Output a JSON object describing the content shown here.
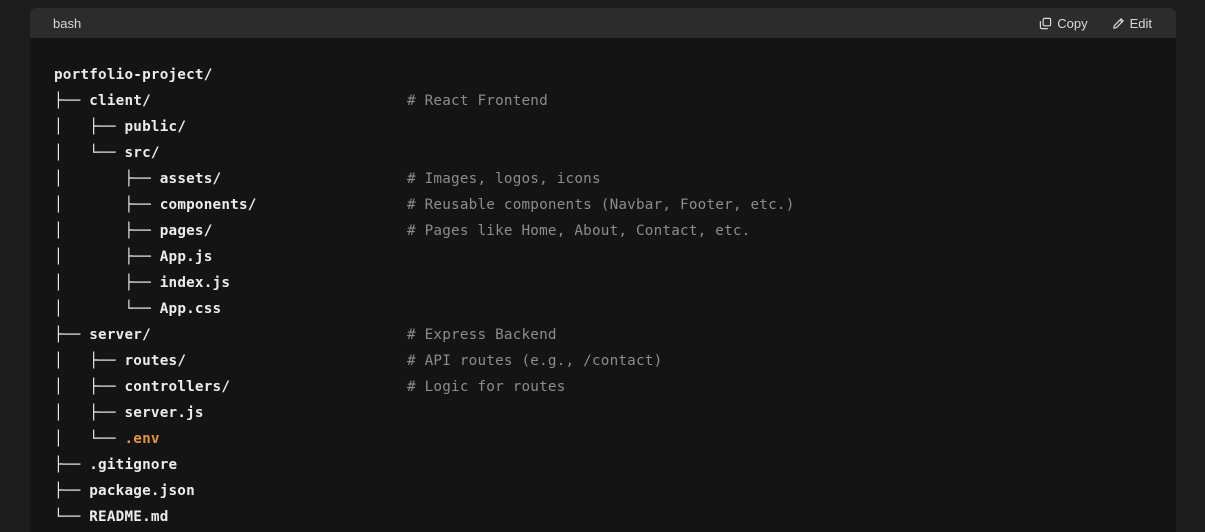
{
  "header": {
    "language": "bash",
    "copy_label": "Copy",
    "edit_label": "Edit",
    "copy_icon": "copy-icon",
    "edit_icon": "pencil-icon"
  },
  "colors": {
    "block_background": "#141414",
    "header_background": "#2c2c2c",
    "text": "#ececec",
    "comment": "#8c8c8c",
    "env_highlight": "#e6953e"
  },
  "lines": [
    {
      "tree": "",
      "name": "portfolio-project/",
      "comment": ""
    },
    {
      "tree": "├── ",
      "name": "client/",
      "comment": "# React Frontend"
    },
    {
      "tree": "│   ├── ",
      "name": "public/",
      "comment": ""
    },
    {
      "tree": "│   └── ",
      "name": "src/",
      "comment": ""
    },
    {
      "tree": "│       ├── ",
      "name": "assets/",
      "comment": "# Images, logos, icons"
    },
    {
      "tree": "│       ├── ",
      "name": "components/",
      "comment": "# Reusable components (Navbar, Footer, etc.)"
    },
    {
      "tree": "│       ├── ",
      "name": "pages/",
      "comment": "# Pages like Home, About, Contact, etc."
    },
    {
      "tree": "│       ├── ",
      "name": "App.js",
      "comment": ""
    },
    {
      "tree": "│       ├── ",
      "name": "index.js",
      "comment": ""
    },
    {
      "tree": "│       └── ",
      "name": "App.css",
      "comment": ""
    },
    {
      "tree": "├── ",
      "name": "server/",
      "comment": "# Express Backend"
    },
    {
      "tree": "│   ├── ",
      "name": "routes/",
      "comment": "# API routes (e.g., /contact)"
    },
    {
      "tree": "│   ├── ",
      "name": "controllers/",
      "comment": "# Logic for routes"
    },
    {
      "tree": "│   ├── ",
      "name": "server.js",
      "comment": ""
    },
    {
      "tree": "│   └── ",
      "name": ".env",
      "comment": "",
      "highlight": true
    },
    {
      "tree": "├── ",
      "name": ".gitignore",
      "comment": ""
    },
    {
      "tree": "├── ",
      "name": "package.json",
      "comment": ""
    },
    {
      "tree": "└── ",
      "name": "README.md",
      "comment": ""
    }
  ]
}
